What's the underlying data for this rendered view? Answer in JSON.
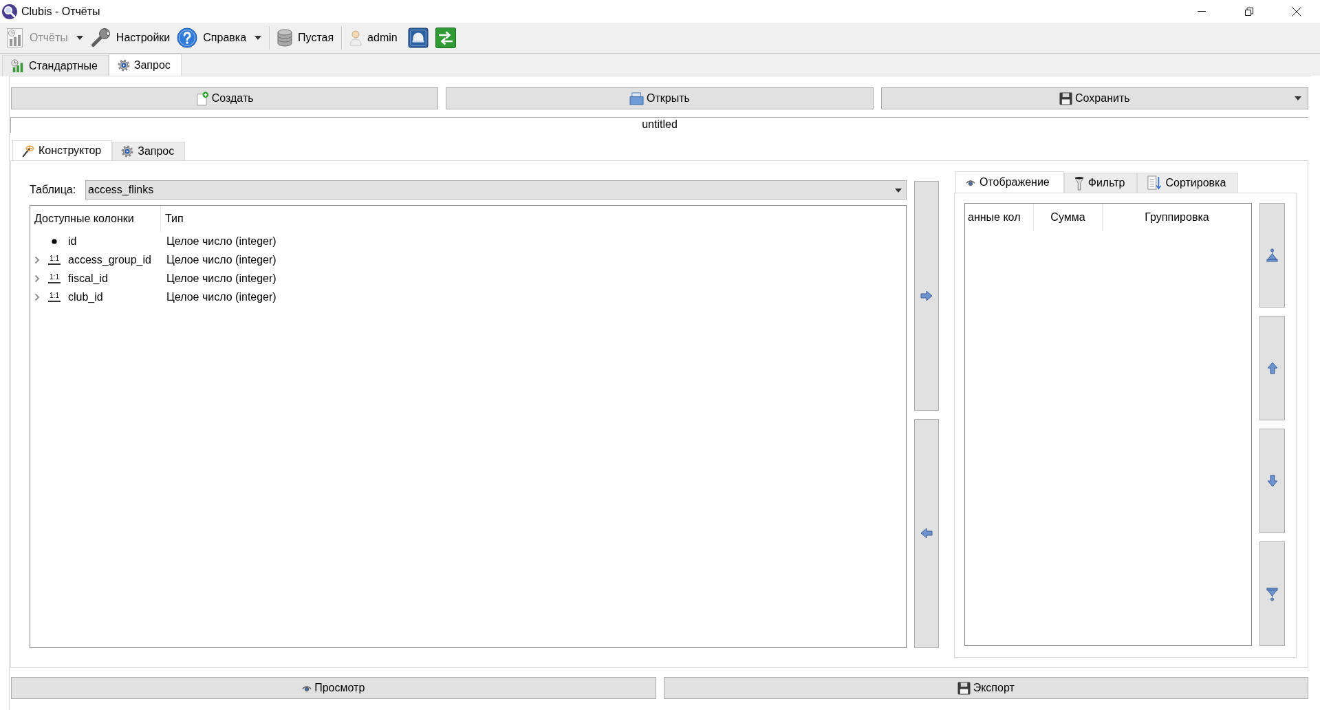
{
  "window": {
    "title": "Clubis - Отчёты"
  },
  "toolbar": {
    "groups": [
      {
        "items": [
          {
            "label": "Отчёты",
            "disabled": true,
            "dropdown": true
          },
          {
            "label": "Настройки",
            "disabled": false,
            "dropdown": false
          },
          {
            "label": "Справка",
            "disabled": false,
            "dropdown": true
          }
        ]
      },
      {
        "items": [
          {
            "label": "Пустая",
            "disabled": false,
            "dropdown": false
          }
        ]
      },
      {
        "items": [
          {
            "label": "admin",
            "disabled": false,
            "dropdown": false
          }
        ]
      }
    ]
  },
  "tabs": [
    {
      "label": "Стандартные",
      "selected": false
    },
    {
      "label": "Запрос",
      "selected": true
    }
  ],
  "actions": [
    {
      "label": "Создать",
      "dropdown": false
    },
    {
      "label": "Открыть",
      "dropdown": false
    },
    {
      "label": "Сохранить",
      "dropdown": true
    }
  ],
  "file_name": {
    "value": "untitled"
  },
  "inner_tabs": [
    {
      "label": "Конструктор",
      "selected": true
    },
    {
      "label": "Запрос",
      "selected": false
    }
  ],
  "constructor": {
    "table_label": "Таблица:",
    "table_value": "access_flinks",
    "columns_tree": {
      "columns": [
        "Доступные колонки",
        "Тип"
      ],
      "rows": [
        {
          "name": "id",
          "type": "Целое число (integer)",
          "kind": "key"
        },
        {
          "name": "access_group_id",
          "type": "Целое число (integer)",
          "kind": "relation",
          "cardinality": "1:1",
          "expanded": false
        },
        {
          "name": "fiscal_id",
          "type": "Целое число (integer)",
          "kind": "relation",
          "cardinality": "1:1",
          "expanded": false
        },
        {
          "name": "club_id",
          "type": "Целое число (integer)",
          "kind": "relation",
          "cardinality": "1:1",
          "expanded": false
        }
      ]
    }
  },
  "display_panel": {
    "tabs": [
      {
        "label": "Отображение",
        "selected": true
      },
      {
        "label": "Фильтр",
        "selected": false
      },
      {
        "label": "Сортировка",
        "selected": false
      }
    ],
    "columns": [
      "анные кол",
      "Сумма",
      "Группировка"
    ]
  },
  "bottom_actions": [
    {
      "label": "Просмотр"
    },
    {
      "label": "Экспорт"
    }
  ]
}
